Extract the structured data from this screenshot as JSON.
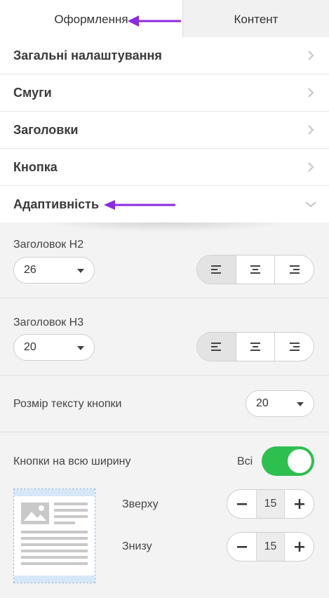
{
  "tabs": {
    "design": "Оформлення",
    "content": "Контент"
  },
  "accordion": [
    {
      "label": "Загальні налаштування",
      "state": "collapsed"
    },
    {
      "label": "Смуги",
      "state": "collapsed"
    },
    {
      "label": "Заголовки",
      "state": "collapsed"
    },
    {
      "label": "Кнопка",
      "state": "collapsed"
    },
    {
      "label": "Адаптивність",
      "state": "expanded"
    }
  ],
  "adaptive": {
    "h2": {
      "label": "Заголовок H2",
      "size": "26",
      "alignment_selected": "left"
    },
    "h3": {
      "label": "Заголовок H3",
      "size": "20",
      "alignment_selected": "left"
    },
    "button_text": {
      "label": "Розмір тексту кнопки",
      "size": "20"
    },
    "full_width": {
      "label": "Кнопки на всю ширину",
      "value_label": "Всі",
      "enabled": true
    },
    "padding": {
      "top": {
        "label": "Зверху",
        "value": "15"
      },
      "bottom": {
        "label": "Знизу",
        "value": "15"
      }
    }
  },
  "colors": {
    "accent_arrow": "#8a2be2",
    "toggle_on": "#2ec04f"
  }
}
